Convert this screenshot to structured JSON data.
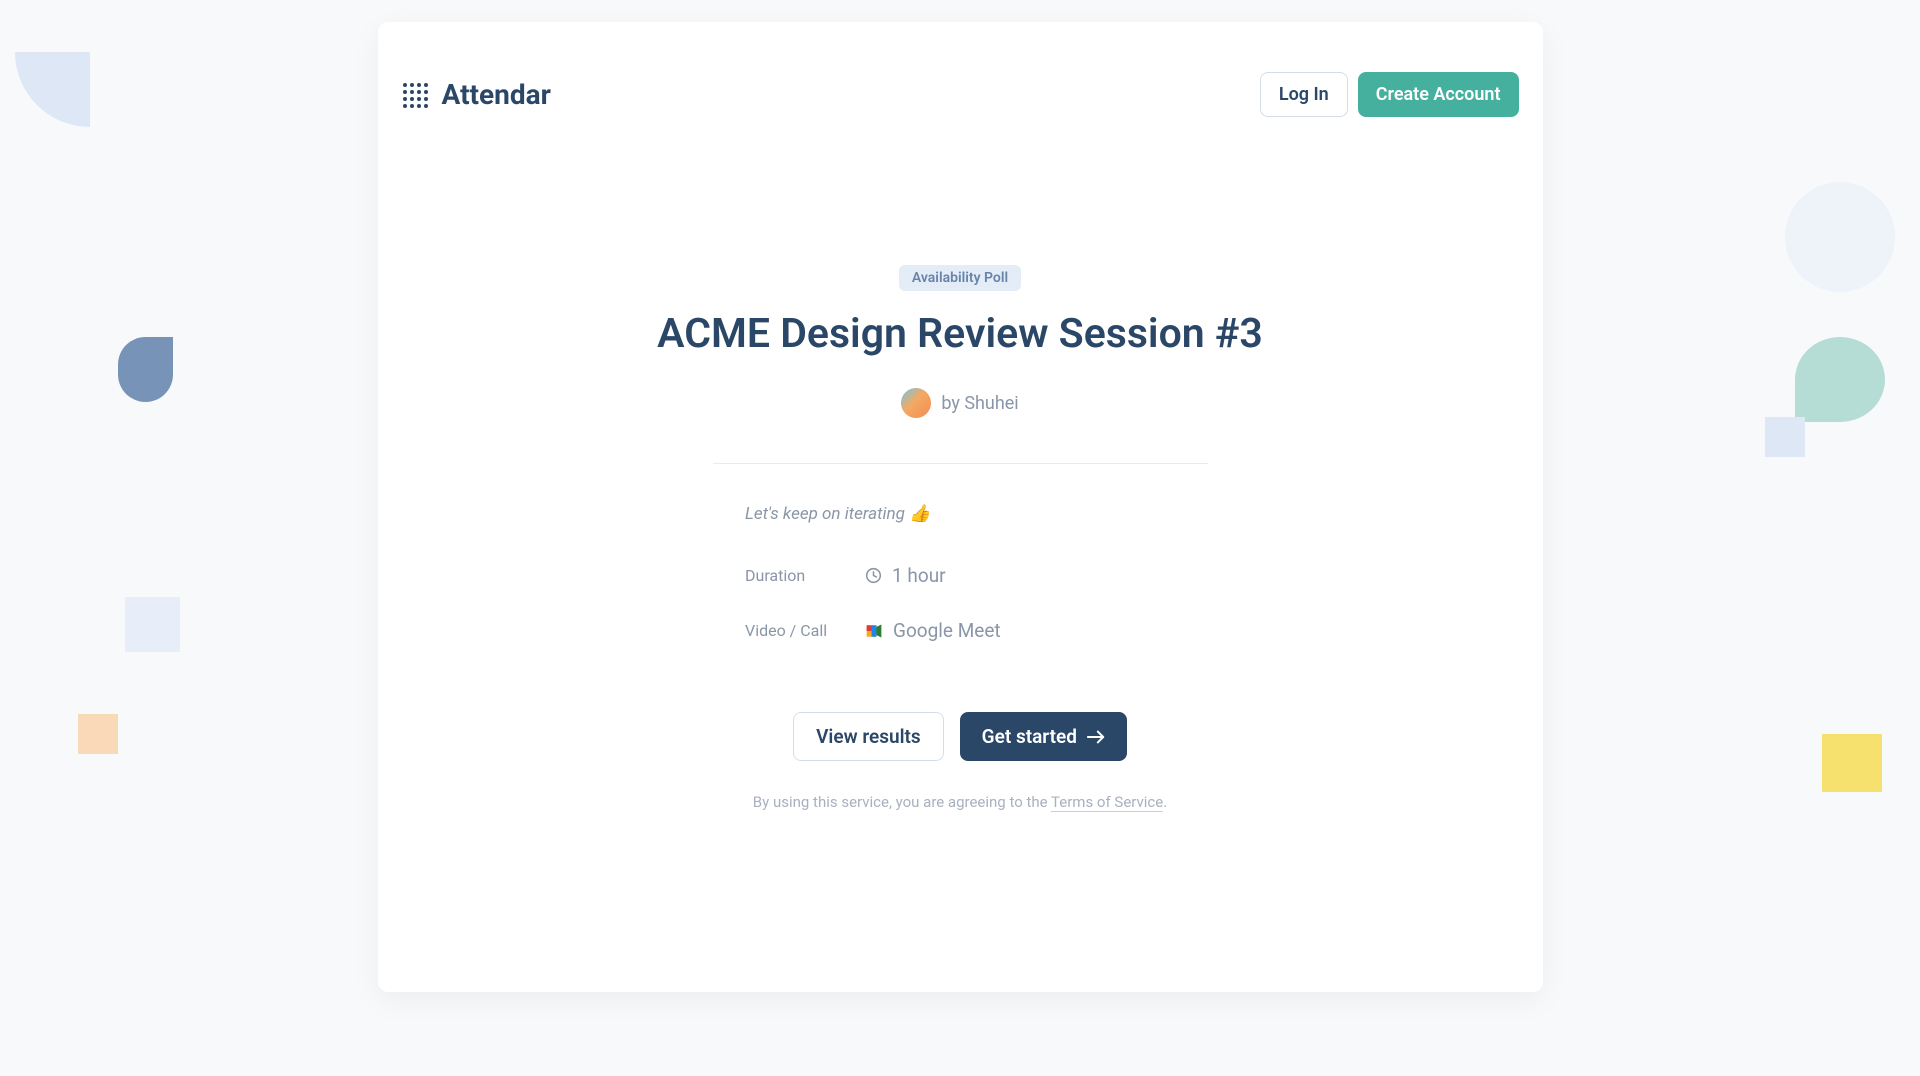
{
  "header": {
    "brand_name": "Attendar",
    "login_label": "Log In",
    "create_account_label": "Create Account"
  },
  "badge": "Availability Poll",
  "title": "ACME Design Review Session #3",
  "author_prefix": "by",
  "author_name": "Shuhei",
  "subtitle": "Let's keep on iterating 👍",
  "details": {
    "duration_label": "Duration",
    "duration_value": "1 hour",
    "video_label": "Video / Call",
    "video_value": "Google Meet"
  },
  "actions": {
    "view_results_label": "View results",
    "get_started_label": "Get started"
  },
  "tos": {
    "prefix": "By using this service, you are agreeing to the ",
    "link_text": "Terms of Service",
    "suffix": "."
  }
}
